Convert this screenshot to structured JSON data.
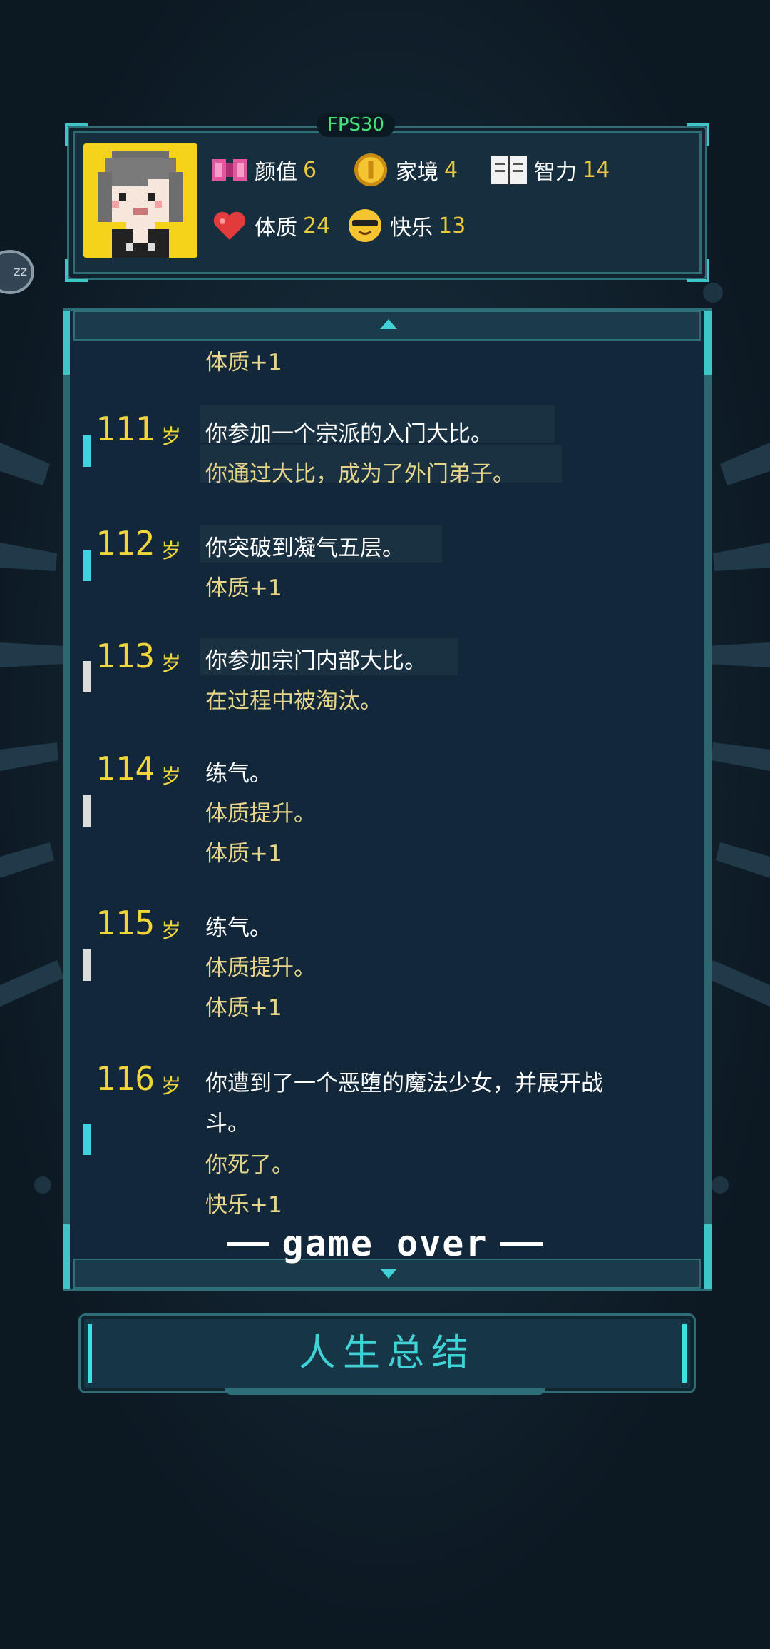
{
  "status": {
    "fps": "FPS30",
    "bubble": "zz"
  },
  "stats": [
    {
      "icon": "ribbon-icon",
      "label": "颜值",
      "value": "6"
    },
    {
      "icon": "coin-icon",
      "label": "家境",
      "value": "4"
    },
    {
      "icon": "book-icon",
      "label": "智力",
      "value": "14"
    },
    {
      "icon": "heart-icon",
      "label": "体质",
      "value": "24"
    },
    {
      "icon": "sunglasses-face-icon",
      "label": "快乐",
      "value": "13"
    }
  ],
  "log": {
    "top_fragment": "体质+1",
    "entries": [
      {
        "age": "111",
        "unit": "岁",
        "marker": "#3fd2e0",
        "lines": [
          "你参加一个宗派的入门大比。",
          "你通过大比，成为了外门弟子。"
        ]
      },
      {
        "age": "112",
        "unit": "岁",
        "marker": "#3fd2e0",
        "lines": [
          "你突破到凝气五层。",
          "体质+1"
        ]
      },
      {
        "age": "113",
        "unit": "岁",
        "marker": "#dcdcdc",
        "lines": [
          "你参加宗门内部大比。",
          "在过程中被淘汰。"
        ]
      },
      {
        "age": "114",
        "unit": "岁",
        "marker": "#dcdcdc",
        "lines": [
          "练气。",
          "体质提升。",
          "体质+1"
        ]
      },
      {
        "age": "115",
        "unit": "岁",
        "marker": "#dcdcdc",
        "lines": [
          "练气。",
          "体质提升。",
          "体质+1"
        ]
      },
      {
        "age": "116",
        "unit": "岁",
        "marker": "#3fd2e0",
        "lines": [
          "你遭到了一个恶堕的魔法少女，并展开战",
          "斗。",
          "你死了。",
          "快乐+1"
        ]
      }
    ],
    "game_over": "game over"
  },
  "summary_button": "人生总结"
}
